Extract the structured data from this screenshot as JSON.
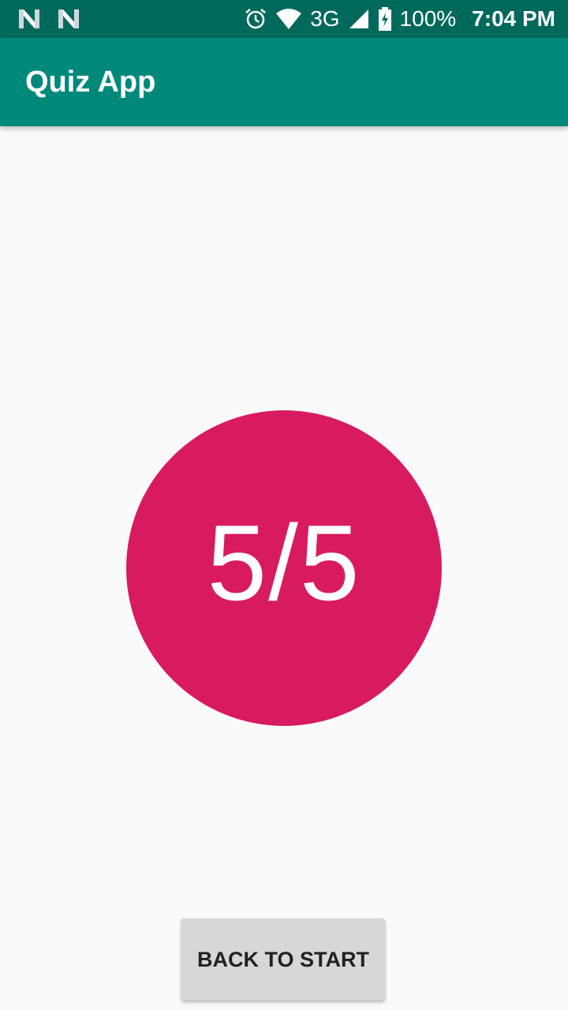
{
  "status_bar": {
    "left_icons": [
      "notification-n-icon",
      "notification-n-icon"
    ],
    "network_type": "3G",
    "battery": "100%",
    "time": "7:04 PM"
  },
  "app_bar": {
    "title": "Quiz App"
  },
  "score": {
    "text": "5/5"
  },
  "actions": {
    "back_to_start_label": "BACK TO START"
  },
  "colors": {
    "status_bar": "#00695c",
    "app_bar": "#00897b",
    "score_circle": "#d81b60",
    "button_bg": "#d6d7d7",
    "background": "#fafafa"
  }
}
